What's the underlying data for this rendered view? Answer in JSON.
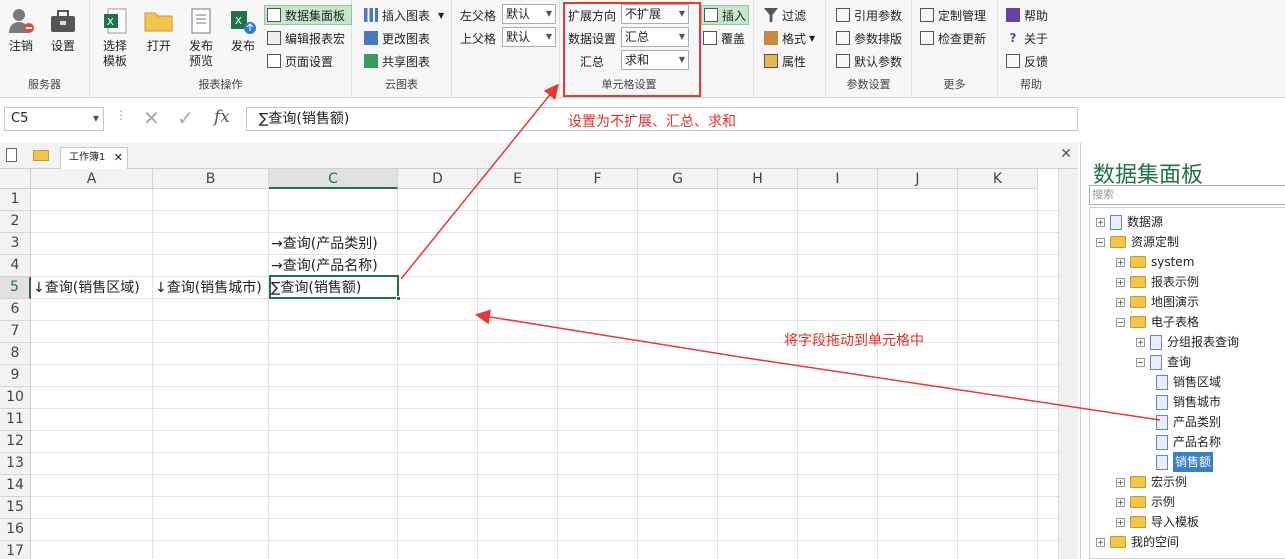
{
  "ribbon": {
    "server": {
      "logout": "注销",
      "settings": "设置",
      "label": "服务器"
    },
    "report": {
      "select_template": "选择\n模板",
      "open": "打开",
      "publish_preview": "发布\n预览",
      "publish": "发布",
      "dataset_panel": "数据集面板",
      "edit_macro": "编辑报表宏",
      "page_setup": "页面设置",
      "label": "报表操作"
    },
    "cloud": {
      "insert_chart": "插入图表",
      "change_chart": "更改图表",
      "share_chart": "共享图表",
      "label": "云图表"
    },
    "parent": {
      "left_parent_label": "左父格",
      "left_parent_value": "默认",
      "top_parent_label": "上父格",
      "top_parent_value": "默认"
    },
    "cell": {
      "expand_label": "扩展方向",
      "expand_value": "不扩展",
      "data_setting_label": "数据设置",
      "data_setting_value": "汇总",
      "summary_label": "汇总",
      "summary_value": "求和",
      "label": "单元格设置"
    },
    "insert": {
      "insert": "插入",
      "overwrite": "覆盖"
    },
    "filter": {
      "filter": "过滤",
      "format": "格式",
      "property": "属性"
    },
    "params": {
      "ref_params": "引用参数",
      "param_layout": "参数排版",
      "default_params": "默认参数",
      "label": "参数设置"
    },
    "more": {
      "custom_manage": "定制管理",
      "check_update": "检查更新",
      "label": "更多"
    },
    "help": {
      "help": "帮助",
      "about": "关于",
      "feedback": "反馈",
      "label": "帮助"
    }
  },
  "formula_bar": {
    "name_box": "C5",
    "formula": "∑查询(销售额)",
    "fx": "fx"
  },
  "sheet": {
    "tab": "工作簿1",
    "columns": [
      "A",
      "B",
      "C",
      "D",
      "E",
      "F",
      "G",
      "H",
      "I",
      "J",
      "K"
    ],
    "rows": [
      "1",
      "2",
      "3",
      "4",
      "5",
      "6",
      "7",
      "8",
      "9",
      "10",
      "11",
      "12",
      "13",
      "14",
      "15",
      "16",
      "17"
    ],
    "cells": {
      "C3": "→查询(产品类别)",
      "C4": "→查询(产品名称)",
      "A5": "↓查询(销售区域)",
      "B5": "↓查询(销售城市)",
      "C5": "∑查询(销售额)"
    }
  },
  "annotations": {
    "top": "设置为不扩展、汇总、求和",
    "mid": "将字段拖动到单元格中"
  },
  "panel": {
    "title": "数据集面板",
    "search_placeholder": "搜索",
    "tree": [
      "数据源",
      "资源定制",
      "system",
      "报表示例",
      "地图演示",
      "电子表格",
      "分组报表查询",
      "查询",
      "销售区域",
      "销售城市",
      "产品类别",
      "产品名称",
      "销售额",
      "宏示例",
      "示例",
      "导入模板",
      "我的空间"
    ]
  },
  "colors": {
    "accent": "#217346",
    "annotation": "#e53935"
  }
}
